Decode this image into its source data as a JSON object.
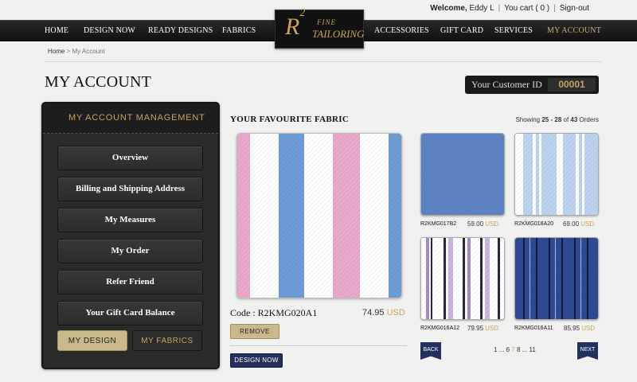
{
  "topbar": {
    "welcome": "Welcome,",
    "user": "Eddy L",
    "cart": "You cart ( 0 )",
    "signout": "Sign-out"
  },
  "nav": {
    "home": "HOME",
    "design_now": "DESIGN NOW",
    "ready_designs": "READY DESIGNS",
    "fabrics": "FABRICS",
    "accessories": "ACCESSORIES",
    "gift_card": "GIFT CARD",
    "services": "SERVICES",
    "my_account": "MY ACCOUNT"
  },
  "logo": {
    "mark": "R",
    "sup": "2",
    "fine": "FINE",
    "tailoring": "TAILORING"
  },
  "breadcrumb": {
    "home": "Home",
    "sep": ">",
    "current": "My Account"
  },
  "page_title": "MY ACCOUNT",
  "customer": {
    "label": "Your Customer ID",
    "id": "00001"
  },
  "sidebar": {
    "title": "MY ACCOUNT MANAGEMENT",
    "items": [
      "Overview",
      "Billing and Shipping Address",
      "My Measures",
      "My Order",
      "Refer Friend",
      "Your Gift Card Balance"
    ],
    "tab_design": "MY DESIGN",
    "tab_fabrics": "MY FABRICS"
  },
  "favourite": {
    "title": "YOUR FAVOURITE FABRIC",
    "showing_prefix": "Showing",
    "showing_range": "25 - 28",
    "showing_of": "of",
    "showing_total": "43",
    "showing_suffix": "Orders",
    "code_label": "Code : R2KMG020A1",
    "price": "74.95",
    "currency": "USD",
    "remove": "REMOVE",
    "design_now": "DESIGN NOW"
  },
  "thumbs": [
    {
      "code": "R2KMG017B2",
      "price": "59.00",
      "currency": "USD"
    },
    {
      "code": "R2KMG018A20",
      "price": "69.00",
      "currency": "USD"
    },
    {
      "code": "R2KMG016A12",
      "price": "79.95",
      "currency": "USD"
    },
    {
      "code": "R2KMG016A11",
      "price": "85.95",
      "currency": "USD"
    }
  ],
  "pager": {
    "back": "BACK",
    "next": "NEXT",
    "pages_before": "1 ... 6",
    "current": "7",
    "pages_after": "8 ... 11"
  },
  "colors": {
    "gold": "#c8a45e",
    "navy": "#24305e",
    "dark": "#1a1a1a"
  }
}
